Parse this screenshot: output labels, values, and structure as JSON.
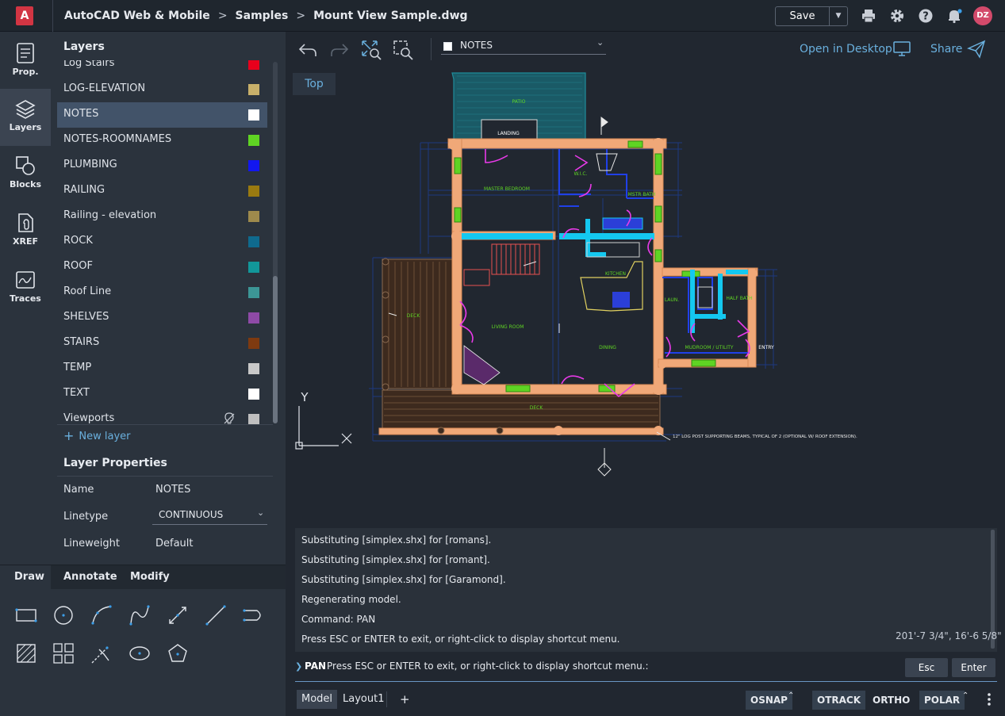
{
  "app": {
    "crumbs": [
      "AutoCAD Web & Mobile",
      "Samples",
      "Mount View Sample.dwg"
    ],
    "save_label": "Save",
    "user_initials": "DZ"
  },
  "rail": [
    {
      "label": "Prop."
    },
    {
      "label": "Layers"
    },
    {
      "label": "Blocks"
    },
    {
      "label": "XREF"
    },
    {
      "label": "Traces"
    }
  ],
  "layers_panel": {
    "title": "Layers",
    "new_layer_label": "New layer",
    "selected": "NOTES",
    "items": [
      {
        "name": "Log Stairs",
        "color": "#e8001c"
      },
      {
        "name": "LOG-ELEVATION",
        "color": "#c8b06a"
      },
      {
        "name": "NOTES",
        "color": "#ffffff"
      },
      {
        "name": "NOTES-ROOMNAMES",
        "color": "#5fd423"
      },
      {
        "name": "PLUMBING",
        "color": "#1217f0"
      },
      {
        "name": "RAILING",
        "color": "#9a7a10"
      },
      {
        "name": "Railing - elevation",
        "color": "#9e8a4c"
      },
      {
        "name": "ROCK",
        "color": "#0f6a8e"
      },
      {
        "name": "ROOF",
        "color": "#12979a"
      },
      {
        "name": "Roof Line",
        "color": "#3c9696"
      },
      {
        "name": "SHELVES",
        "color": "#8e4aa6"
      },
      {
        "name": "STAIRS",
        "color": "#7e3a10"
      },
      {
        "name": "TEMP",
        "color": "#c8c8c8"
      },
      {
        "name": "TEXT",
        "color": "#ffffff"
      },
      {
        "name": "Viewports",
        "color": "#bfbfbf"
      }
    ]
  },
  "layer_properties": {
    "title": "Layer Properties",
    "name_label": "Name",
    "name_value": "NOTES",
    "linetype_label": "Linetype",
    "linetype_value": "CONTINUOUS",
    "lineweight_label": "Lineweight",
    "lineweight_value": "Default"
  },
  "draw_tabs": [
    "Draw",
    "Annotate",
    "Modify"
  ],
  "canvas_toolbar": {
    "current_layer": "NOTES",
    "open_desktop_label": "Open in Desktop",
    "share_label": "Share"
  },
  "view": {
    "label": "Top",
    "ucs_x": "X",
    "ucs_y": "Y"
  },
  "command_history": [
    "Substituting [simplex.shx] for [romans].",
    "Substituting [simplex.shx] for [romant].",
    "Substituting [simplex.shx] for [Garamond].",
    "Regenerating model.",
    "Command: PAN",
    "Press ESC or ENTER to exit, or right-click to display shortcut menu."
  ],
  "coordinates": "201'-7 3/4\", 16'-6 5/8\"",
  "command_line": {
    "command": "PAN",
    "prompt": "Press ESC or ENTER to exit, or right-click to display shortcut menu.:",
    "esc_label": "Esc",
    "enter_label": "Enter"
  },
  "status": {
    "tabs": [
      "Model",
      "Layout1"
    ],
    "add_label": "+",
    "toggles": [
      {
        "label": "OSNAP",
        "on": true
      },
      {
        "label": "OTRACK",
        "on": true
      },
      {
        "label": "ORTHO",
        "on": false
      },
      {
        "label": "POLAR",
        "on": true
      }
    ]
  },
  "drawing": {
    "labels": [
      "PATIO",
      "LANDING",
      "W.I.C.",
      "MSTR BATH",
      "MASTER BEDROOM",
      "KITCHEN",
      "LIVING ROOM",
      "DINING",
      "LAUN.",
      "HALF BATH",
      "MUDROOM / UTILITY",
      "DECK",
      "DECK",
      "ENTRY"
    ],
    "note": "12\" LOG POST SUPPORTING BEAMS, TYPICAL OF 2 (OPTIONAL W/ ROOF EXTENSION)."
  }
}
